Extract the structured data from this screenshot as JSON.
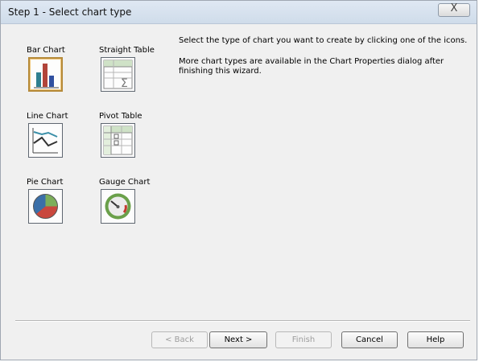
{
  "window": {
    "title": "Step 1 - Select chart type",
    "close_glyph": "X"
  },
  "chart_options": [
    {
      "label": "Bar Chart",
      "icon": "bar-chart-icon",
      "selected": true
    },
    {
      "label": "Straight Table",
      "icon": "straight-table-icon",
      "selected": false
    },
    {
      "label": "Line Chart",
      "icon": "line-chart-icon",
      "selected": false
    },
    {
      "label": "Pivot Table",
      "icon": "pivot-table-icon",
      "selected": false
    },
    {
      "label": "Pie Chart",
      "icon": "pie-chart-icon",
      "selected": false
    },
    {
      "label": "Gauge Chart",
      "icon": "gauge-chart-icon",
      "selected": false
    }
  ],
  "instructions": {
    "line1": "Select the type of chart you want to create by clicking  one of the icons.",
    "line2": "More chart types are available in the Chart Properties dialog after finishing this wizard."
  },
  "buttons": {
    "back": "< Back",
    "next": "Next >",
    "finish": "Finish",
    "cancel": "Cancel",
    "help": "Help"
  },
  "colors": {
    "selected_border": "#b58a3a",
    "bar_1": "#2f7f8f",
    "bar_2": "#b1443a",
    "bar_3": "#3050a0",
    "table_header": "#cfe2c7"
  }
}
